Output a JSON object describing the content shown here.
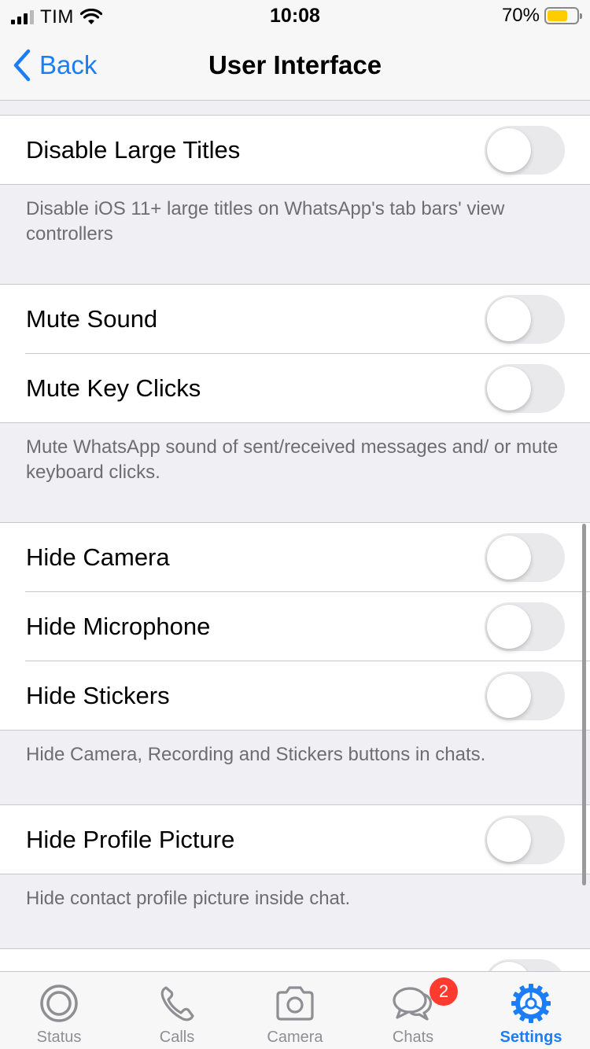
{
  "status_bar": {
    "carrier": "TIM",
    "time": "10:08",
    "battery_percent": "70%",
    "battery_level": 0.7,
    "battery_color": "#ffcc00",
    "signal_bars": 4,
    "signal_active": 3
  },
  "nav": {
    "back_label": "Back",
    "title": "User Interface",
    "accent_color": "#1c7ef5"
  },
  "sections": [
    {
      "rows": [
        {
          "label": "Disable Large Titles",
          "enabled": false
        }
      ],
      "footer": "Disable iOS 11+ large titles on WhatsApp's tab bars' view controllers"
    },
    {
      "rows": [
        {
          "label": "Mute Sound",
          "enabled": false
        },
        {
          "label": "Mute Key Clicks",
          "enabled": false
        }
      ],
      "footer": "Mute WhatsApp sound of sent/received messages and/ or mute keyboard clicks."
    },
    {
      "rows": [
        {
          "label": "Hide Camera",
          "enabled": false
        },
        {
          "label": "Hide Microphone",
          "enabled": false
        },
        {
          "label": "Hide Stickers",
          "enabled": false
        }
      ],
      "footer": "Hide Camera, Recording and Stickers buttons in chats."
    },
    {
      "rows": [
        {
          "label": "Hide Profile Picture",
          "enabled": false
        }
      ],
      "footer": "Hide contact profile picture inside chat."
    }
  ],
  "tab_bar": {
    "tabs": [
      {
        "label": "Status",
        "icon": "status-icon",
        "active": false
      },
      {
        "label": "Calls",
        "icon": "phone-icon",
        "active": false
      },
      {
        "label": "Camera",
        "icon": "camera-icon",
        "active": false
      },
      {
        "label": "Chats",
        "icon": "chats-icon",
        "active": false
      },
      {
        "label": "Settings",
        "icon": "settings-gear-icon",
        "active": true
      }
    ],
    "chats_badge": "2",
    "badge_color": "#ff3b30",
    "active_color": "#1c7ef5",
    "inactive_color": "#8e8e93"
  }
}
